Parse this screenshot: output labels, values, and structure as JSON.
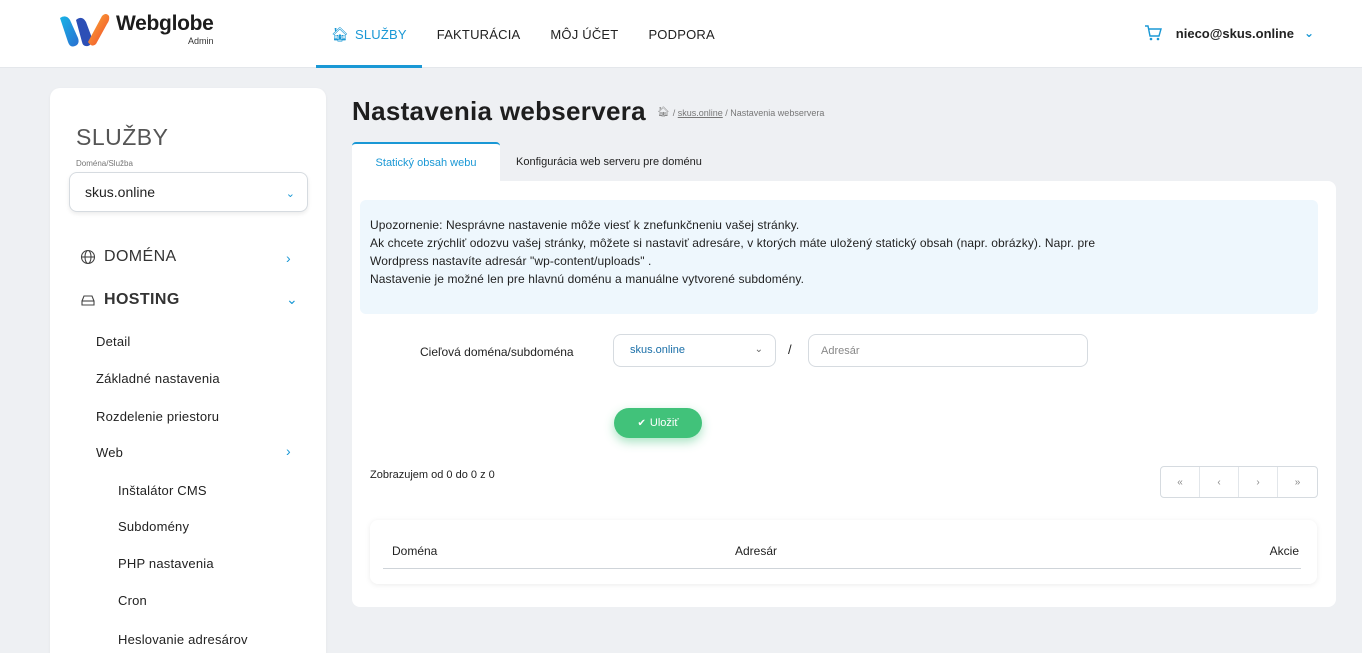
{
  "brand": {
    "name": "Webglobe",
    "sub": "Admin",
    "colors": {
      "accent": "#1a98d5",
      "success": "#41c27a"
    }
  },
  "nav": {
    "items": [
      {
        "label": "SLUŽBY",
        "icon": "home-icon",
        "active": true
      },
      {
        "label": "FAKTURÁCIA"
      },
      {
        "label": "MÔJ ÚČET"
      },
      {
        "label": "PODPORA"
      }
    ]
  },
  "user": {
    "email": "nieco@skus.online",
    "cart_icon": "cart-icon",
    "chevron": "˅"
  },
  "sidebar": {
    "title": "SLUŽBY",
    "subtitle": "Doména/Služba",
    "select_value": "skus.online",
    "sections": [
      {
        "label": "DOMÉNA",
        "icon": "globe-icon"
      },
      {
        "label": "HOSTING",
        "icon": "server-icon"
      }
    ],
    "hosting_items": [
      "Detail",
      "Základné nastavenia",
      "Rozdelenie priestoru",
      "Web"
    ],
    "web_items": [
      "Inštalátor CMS",
      "Subdomény",
      "PHP nastavenia",
      "Cron",
      "Heslovanie adresárov"
    ]
  },
  "main": {
    "title": "Nastavenia webservera",
    "breadcrumb": {
      "sep": "/",
      "link": "skus.online",
      "current": "/ Nastavenia webservera"
    },
    "tabs": [
      {
        "label": "Statický obsah webu",
        "active": true
      },
      {
        "label": "Konfigurácia web serveru pre doménu"
      }
    ],
    "alert_lines": [
      "Upozornenie: Nesprávne nastavenie môže viesť k znefunkčneniu vašej stránky.",
      "Ak chcete zrýchliť odozvu vašej stránky, môžete si nastaviť adresáre, v ktorých máte uložený statický obsah (napr. obrázky). Napr. pre",
      "Wordpress nastavíte adresár \"wp-content/uploads\" .",
      "Nastavenie je možné len pre hlavnú doménu a manuálne vytvorené subdomény."
    ],
    "form": {
      "label": "Cieľová doména/subdoména",
      "select_value": "skus.online",
      "slash": "/",
      "input_placeholder": "Adresár",
      "input_value": ""
    },
    "save_label": "Uložiť",
    "showing": "Zobrazujem od 0 do 0 z 0",
    "pager": [
      "«",
      "‹",
      "›",
      "»"
    ],
    "table": {
      "columns": [
        "Doména",
        "Adresár",
        "Akcie"
      ],
      "rows": []
    }
  }
}
